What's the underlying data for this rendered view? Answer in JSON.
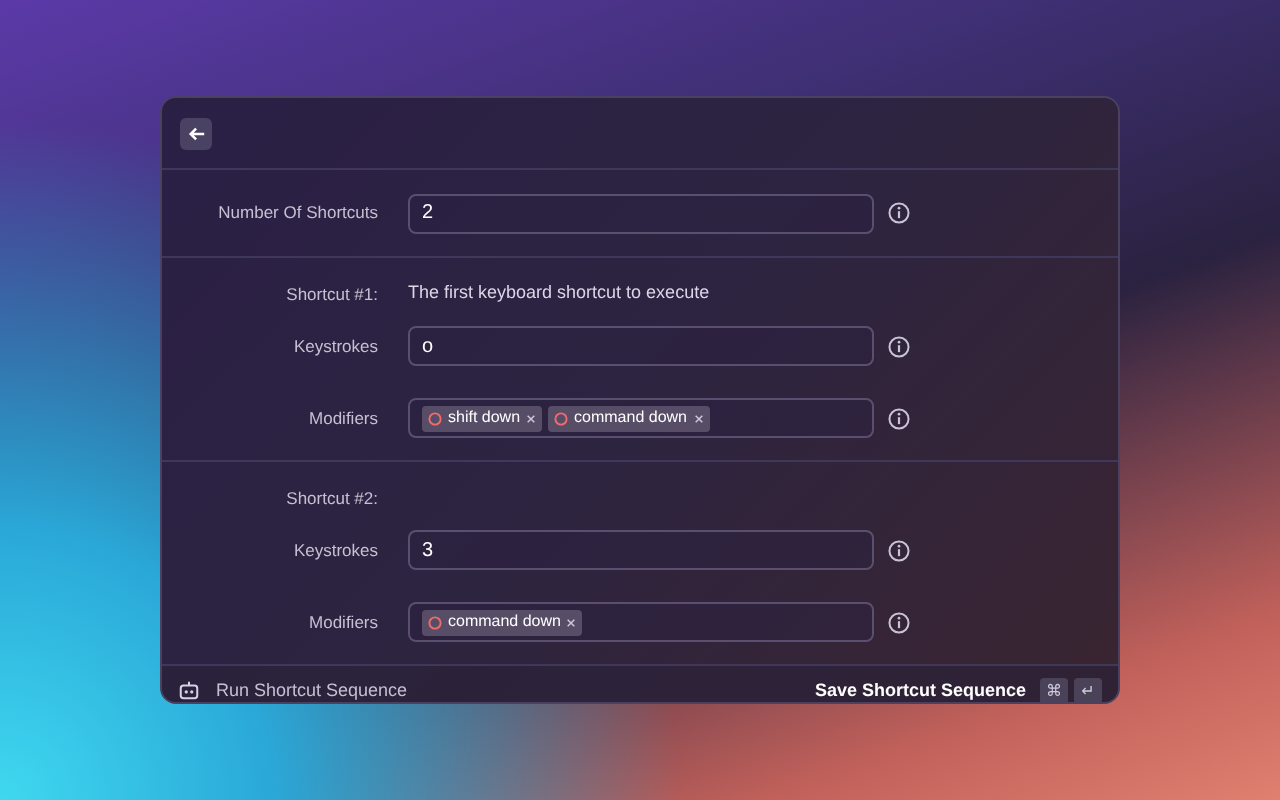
{
  "number_of_shortcuts": {
    "label": "Number Of Shortcuts",
    "value": "2"
  },
  "shortcuts": [
    {
      "title": "Shortcut #1:",
      "description": "The first keyboard shortcut to execute",
      "keystrokes": {
        "label": "Keystrokes",
        "value": "o"
      },
      "modifiers": {
        "label": "Modifiers",
        "tags": [
          "shift down",
          "command down"
        ]
      }
    },
    {
      "title": "Shortcut #2:",
      "keystrokes": {
        "label": "Keystrokes",
        "value": "3"
      },
      "modifiers": {
        "label": "Modifiers",
        "tags": [
          "command down"
        ]
      }
    }
  ],
  "footer": {
    "command": "Run Shortcut Sequence",
    "action": "Save Shortcut Sequence",
    "keys": [
      "⌘",
      "↵"
    ]
  }
}
